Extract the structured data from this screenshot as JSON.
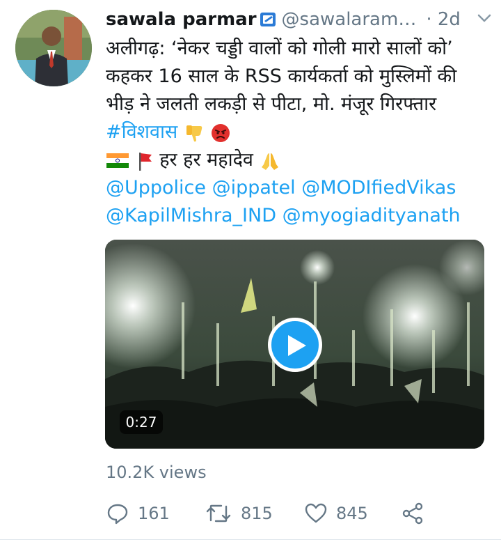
{
  "tweet": {
    "display_name": "sawala parmar",
    "handle": "@sawalaram…",
    "time": "· 2d",
    "text_lines": [
      "अलीगढ़: ‘नेकर चड्डी वालों को गोली मारो सालों को’",
      "कहकर 16 साल के RSS कार्यकर्ता को मुस्लिमों की",
      "भीड़ ने जलती लकड़ी से पीटा, मो. मंजूर गिरफ्तार"
    ],
    "hashtag": "#विशवास",
    "chant": "हर हर महादेव",
    "mentions_line1": " @Uppolice @ippatel @MODIfiedVikas",
    "mentions_line2": "@KapilMishra_IND @myogiadityanath",
    "video_duration": "0:27",
    "views": "10.2K views",
    "replies": "161",
    "retweets": "815",
    "likes": "845"
  },
  "icons": {
    "verified": "verified-badge-icon",
    "caret": "chevron-down-icon",
    "reply": "reply-icon",
    "retweet": "retweet-icon",
    "like": "heart-icon",
    "share": "share-icon",
    "play": "play-icon"
  },
  "colors": {
    "link": "#1da1f2",
    "secondary": "#657786",
    "text": "#14171a"
  }
}
